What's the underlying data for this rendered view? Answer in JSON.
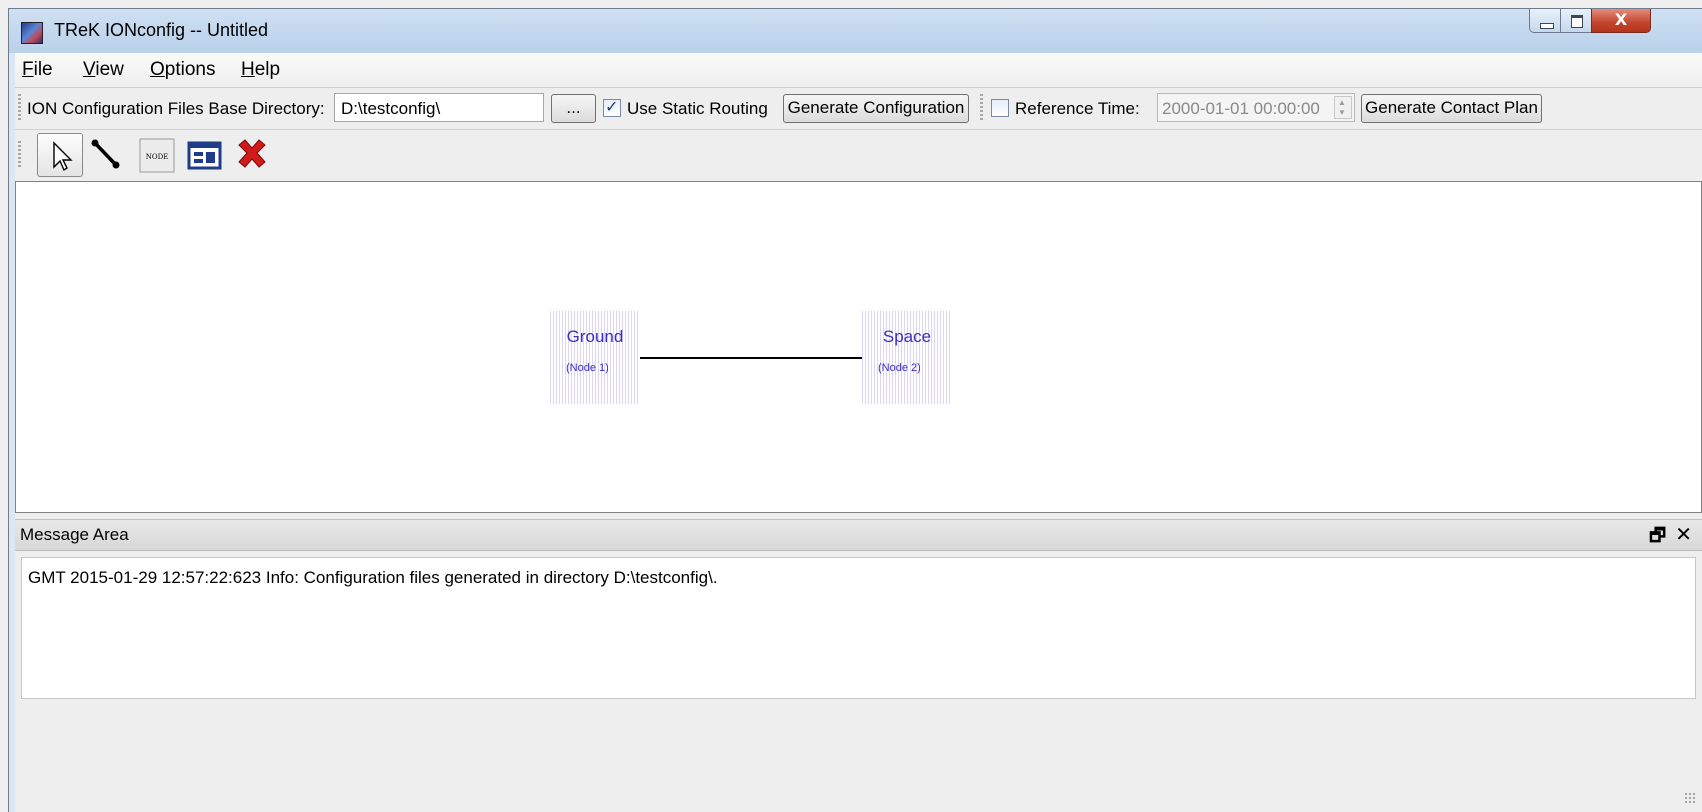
{
  "window": {
    "title": "TReK IONconfig -- Untitled",
    "controls": {
      "minimize": "minimize",
      "maximize": "maximize",
      "close": "X"
    }
  },
  "menu": {
    "file": {
      "key": "F",
      "rest": "ile"
    },
    "view": {
      "key": "V",
      "rest": "iew"
    },
    "options": {
      "key": "O",
      "rest": "ptions"
    },
    "help": {
      "key": "H",
      "rest": "elp"
    }
  },
  "config_toolbar": {
    "base_dir_label": "ION Configuration Files Base Directory:",
    "base_dir_value": "D:\\testconfig\\",
    "browse_label": "...",
    "static_routing_label": "Use Static Routing",
    "static_routing_checked": true,
    "generate_config_label": "Generate Configuration",
    "reference_time_checked": false,
    "reference_time_label": "Reference Time:",
    "reference_time_value": "2000-01-01 00:00:00",
    "generate_contact_plan_label": "Generate Contact Plan"
  },
  "tools": [
    {
      "icon": "select-pointer-icon",
      "selected": true
    },
    {
      "icon": "link-tool-icon",
      "selected": false
    },
    {
      "icon": "node-tool-icon",
      "label": "NODE",
      "selected": false
    },
    {
      "icon": "properties-icon",
      "selected": false
    },
    {
      "icon": "delete-icon",
      "selected": false
    }
  ],
  "diagram": {
    "nodes": [
      {
        "name": "Ground",
        "sub": "(Node 1)"
      },
      {
        "name": "Space",
        "sub": "(Node 2)"
      }
    ],
    "links": [
      {
        "from": "Ground",
        "to": "Space"
      }
    ]
  },
  "message_area": {
    "title": "Message Area",
    "messages": [
      "GMT 2015-01-29 12:57:22:623  Info:  Configuration files generated in directory D:\\testconfig\\."
    ]
  },
  "colors": {
    "node_text": "#3b2fc0",
    "node_fill": "#dcd6f2",
    "close_button": "#c2452d"
  }
}
